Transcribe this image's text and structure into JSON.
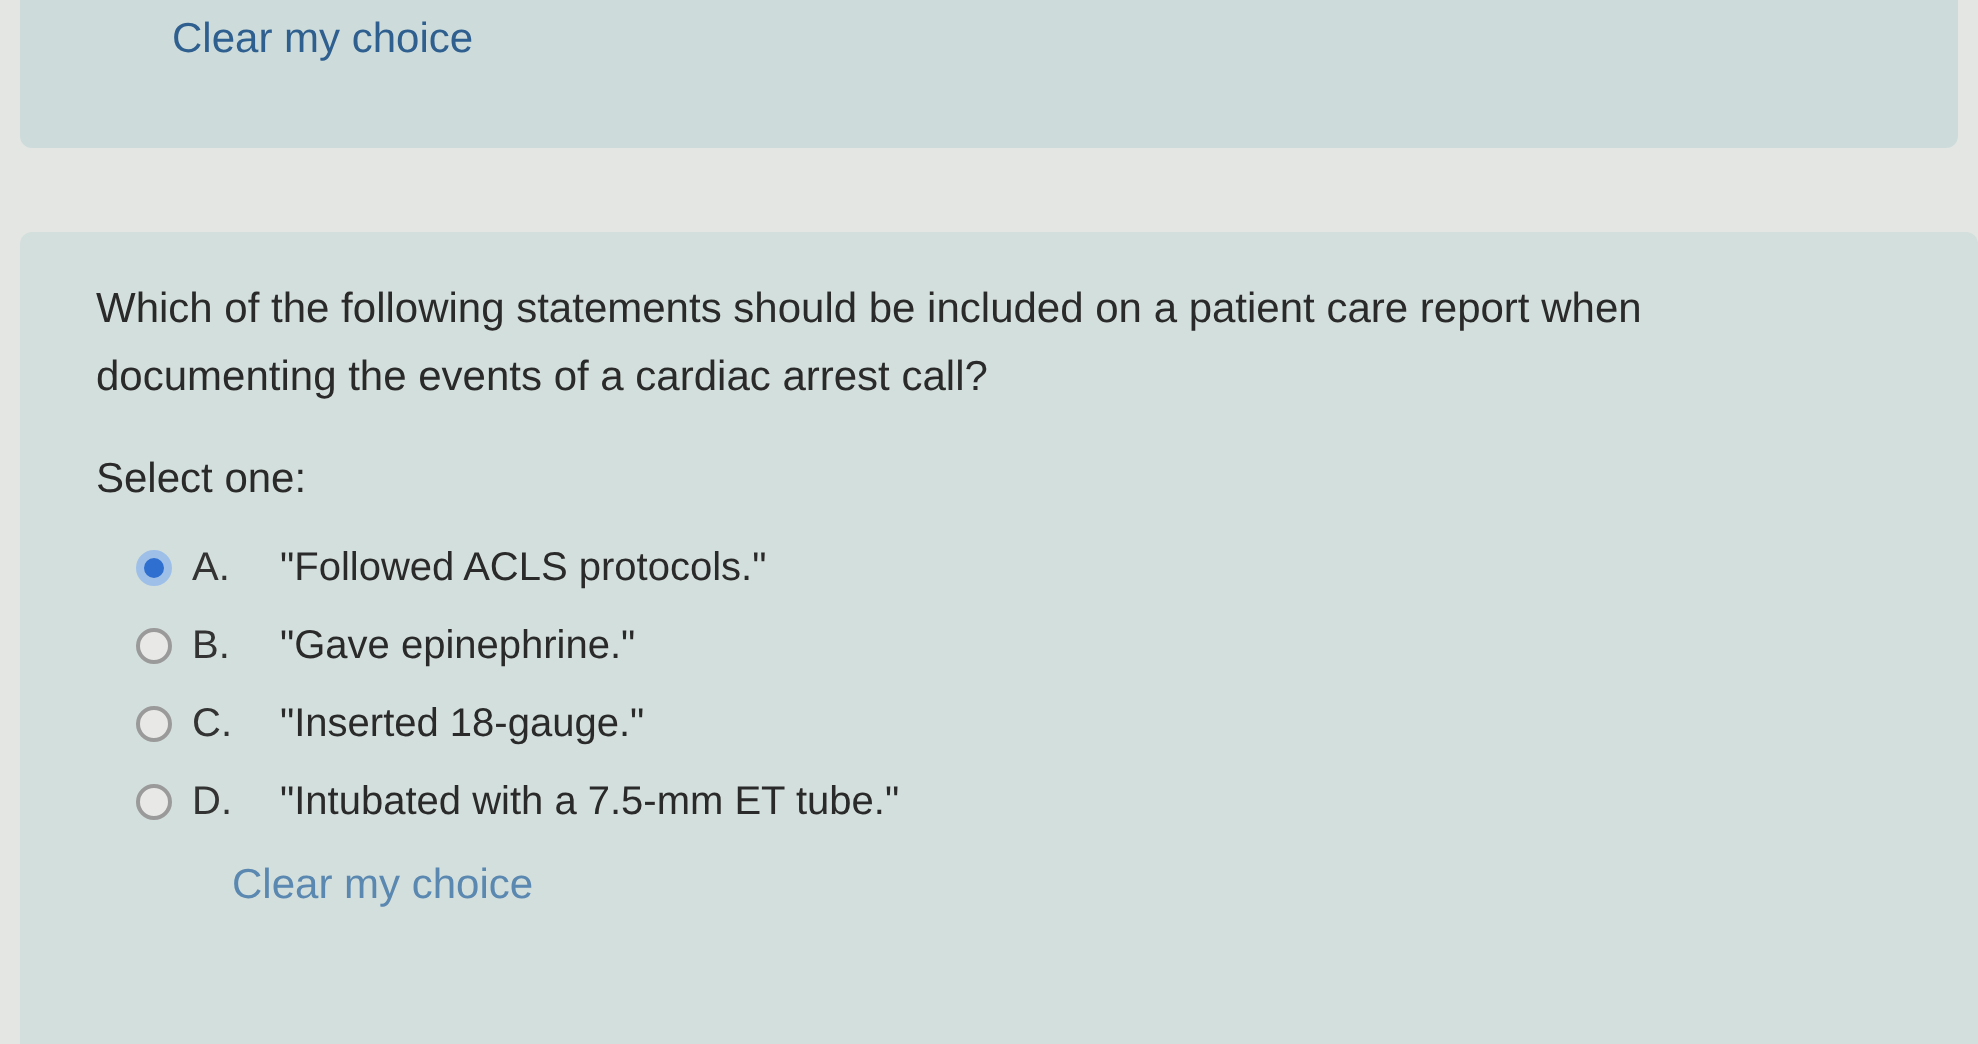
{
  "previous_question": {
    "clear_link": "Clear my choice"
  },
  "question": {
    "text": "Which of the following statements should be included on a patient care report when documenting the events of a cardiac arrest call?",
    "prompt": "Select one:",
    "options": [
      {
        "letter": "A.",
        "text": "\"Followed ACLS protocols.\"",
        "selected": true
      },
      {
        "letter": "B.",
        "text": "\"Gave epinephrine.\"",
        "selected": false
      },
      {
        "letter": "C.",
        "text": "\"Inserted 18-gauge.\"",
        "selected": false
      },
      {
        "letter": "D.",
        "text": "\"Intubated with a 7.5-mm ET tube.\"",
        "selected": false
      }
    ],
    "clear_link": "Clear my choice"
  }
}
